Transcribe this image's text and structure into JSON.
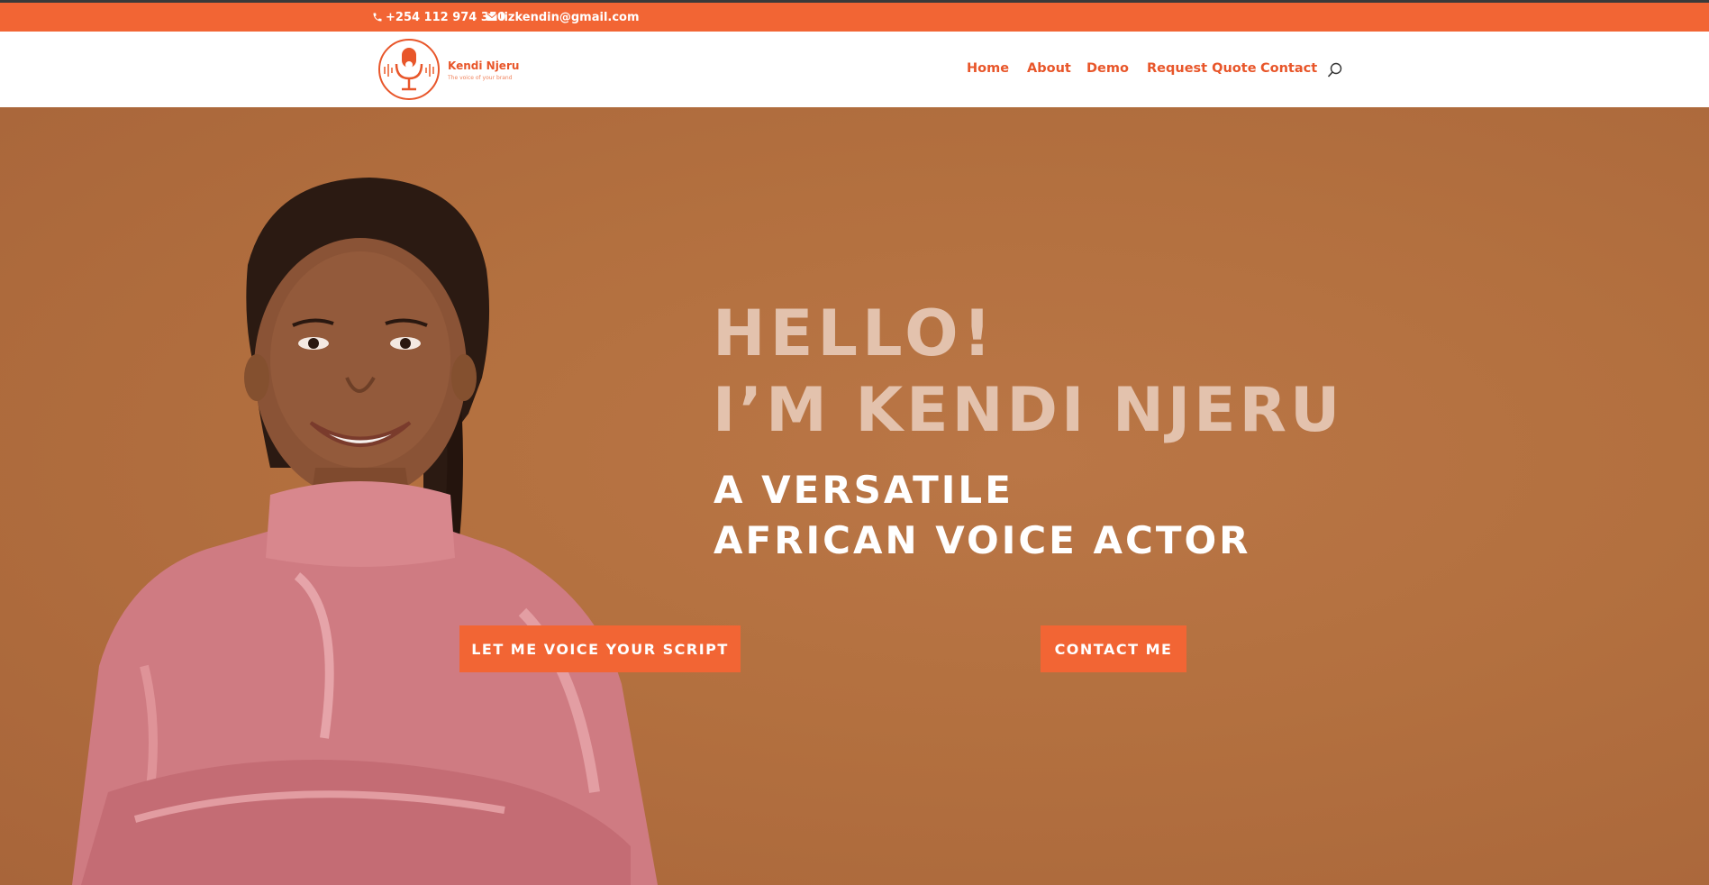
{
  "topbar": {
    "phone": "+254 112 974 350",
    "email": "lizkendin@gmail.com",
    "phone_icon": "phone-icon",
    "email_icon": "envelope-icon"
  },
  "brand": {
    "name": "Kendi Njeru",
    "tagline": "The voice of your brand"
  },
  "nav": {
    "items": [
      {
        "label": "Home"
      },
      {
        "label": "About"
      },
      {
        "label": "Demo"
      },
      {
        "label": "Request Quote"
      },
      {
        "label": "Contact"
      }
    ],
    "search_icon": "search-icon"
  },
  "hero": {
    "greeting": "HELLO!",
    "name_line": "I’M KENDI NJERU",
    "sub_line1": "A VERSATILE",
    "sub_line2": "AFRICAN VOICE ACTOR",
    "cta_primary": "LET ME VOICE YOUR SCRIPT",
    "cta_secondary": "CONTACT ME"
  },
  "colors": {
    "accent": "#f26534",
    "hero_bg": "#b3703f",
    "heading_light": "#e3c2ad"
  }
}
